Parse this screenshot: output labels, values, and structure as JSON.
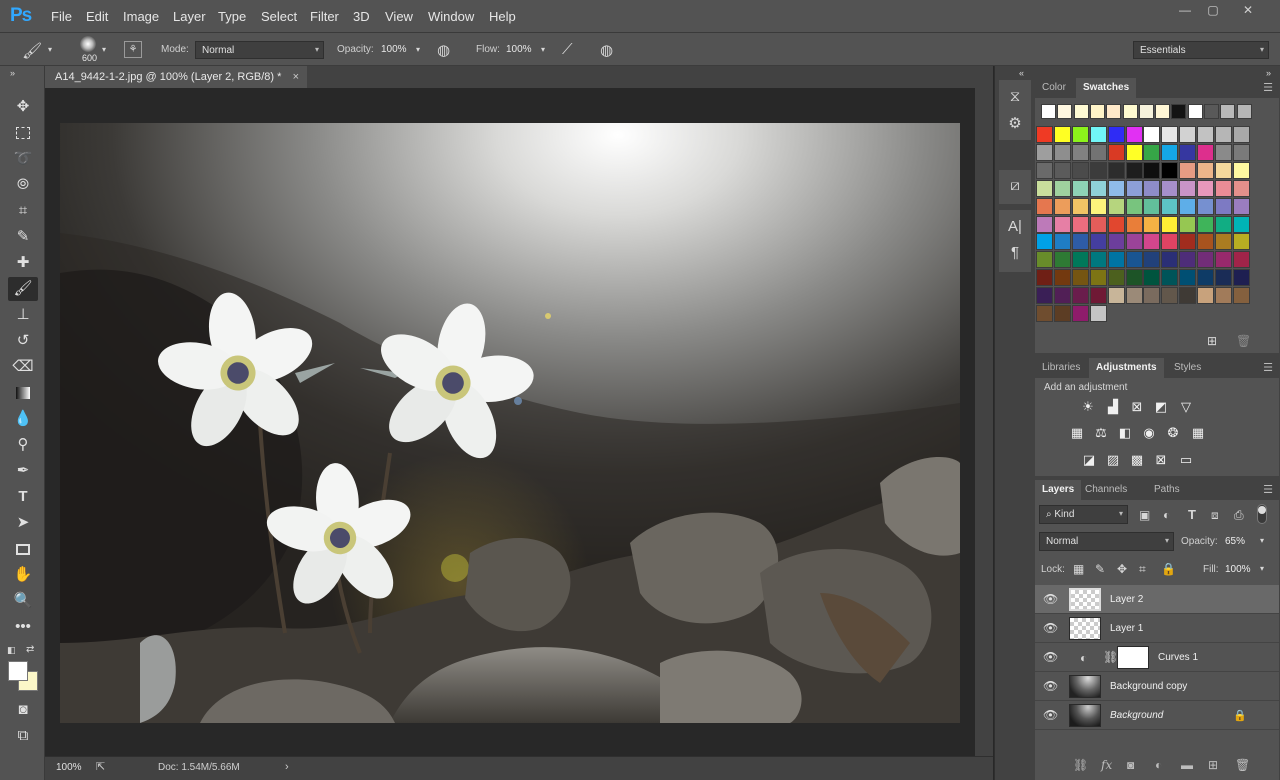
{
  "app": {
    "logo": "Ps",
    "accent": "#31a8ff"
  },
  "menu": [
    "File",
    "Edit",
    "Image",
    "Layer",
    "Type",
    "Select",
    "Filter",
    "3D",
    "View",
    "Window",
    "Help"
  ],
  "window_controls": [
    "minimize-icon",
    "restore-icon",
    "close-icon"
  ],
  "options_bar": {
    "brush_size": "600",
    "mode_label": "Mode:",
    "mode_value": "Normal",
    "opacity_label": "Opacity:",
    "opacity_value": "100%",
    "flow_label": "Flow:",
    "flow_value": "100%",
    "workspace": "Essentials"
  },
  "document": {
    "tab_title": "A14_9442-1-2.jpg @ 100% (Layer 2, RGB/8) *",
    "close": "×"
  },
  "status": {
    "zoom": "100%",
    "doc": "Doc: 1.54M/5.66M",
    "arrow": "›"
  },
  "tools": [
    "move-tool",
    "marquee-tool",
    "lasso-tool",
    "quick-select-tool",
    "crop-tool",
    "eyedropper-tool",
    "healing-brush-tool",
    "brush-tool",
    "clone-stamp-tool",
    "history-brush-tool",
    "eraser-tool",
    "gradient-tool",
    "blur-tool",
    "dodge-tool",
    "pen-tool",
    "type-tool",
    "path-select-tool",
    "rectangle-tool",
    "hand-tool",
    "zoom-tool",
    "more-tools"
  ],
  "colors": {
    "foreground": "#ffffff",
    "background": "#fbf7c8"
  },
  "color_panel": {
    "tabs": [
      "Color",
      "Swatches"
    ],
    "active_tab": "Swatches",
    "recent": [
      "#ffffff",
      "#fff7e0",
      "#fffbd4",
      "#fff4c8",
      "#ffe9c9",
      "#fffbd0",
      "#f6f2dc",
      "#fff6d5",
      "#141414",
      "#ffffff",
      "#595959",
      "#b9b9b9",
      "#b6b6b6"
    ],
    "swatches": [
      [
        "#ef3a24",
        "#ffff23",
        "#8cf31b",
        "#71f6f7",
        "#2f2cf5",
        "#e130f3",
        "#ffffff",
        "#e6e6e6",
        "#d2d2d2",
        "#c2c2c2",
        "#b6b6b6",
        "#a9a9a9"
      ],
      [
        "#9e9e9e",
        "#8e8e8e",
        "#818181",
        "#737373",
        "#d93a24",
        "#ffff26",
        "#36a647",
        "#14a7e5",
        "#3637a0",
        "#dd2f8d",
        "#8a8a8a",
        "#7a7a7a"
      ],
      [
        "#6a6a6a",
        "#5b5b5b",
        "#4b4b4b",
        "#3c3c3c",
        "#2d2d2d",
        "#1e1e1e",
        "#0f0f0f",
        "#000000",
        "#e69c83",
        "#ecb58a",
        "#f4d89c",
        "#fef8a1"
      ],
      [
        "#c9de9c",
        "#9fd19e",
        "#8ed2b6",
        "#8fd1d9",
        "#8fbbe9",
        "#8d9fd8",
        "#8e8cc9",
        "#a68fcb",
        "#c994c7",
        "#e798bb",
        "#ea8c96",
        "#e4908b"
      ],
      [
        "#e5774f",
        "#ec9d5b",
        "#f1c465",
        "#fdf37c",
        "#b6d57e",
        "#78c47e",
        "#62bf9b",
        "#5dc3c5",
        "#5eaee8",
        "#7690d0",
        "#7d7ac3",
        "#9a7dc0"
      ],
      [
        "#bd7ab9",
        "#e67fa5",
        "#eb6d7e",
        "#e45d5a",
        "#e1472f",
        "#e97e39",
        "#f4b244",
        "#ffee35",
        "#96c752",
        "#3fb45a",
        "#11ad83",
        "#00b3b6"
      ],
      [
        "#00a1e6",
        "#1f7dc4",
        "#2e5ca7",
        "#443ea0",
        "#6c3e9c",
        "#9b4399",
        "#d3468c",
        "#e04363",
        "#a12c1e",
        "#a8531e",
        "#ab7c21",
        "#b7ad22"
      ],
      [
        "#688c2a",
        "#2e7a34",
        "#00785a",
        "#00787f",
        "#0074a3",
        "#195592",
        "#22417a",
        "#2b2f76",
        "#4e2d79",
        "#722d78",
        "#98296c",
        "#a12449"
      ],
      [
        "#6f1f15",
        "#73390f",
        "#755512",
        "#7d7414",
        "#4c601e",
        "#1d5427",
        "#00543e",
        "#005459",
        "#004f73",
        "#0e3b66",
        "#1a2c56",
        "#1e1f51"
      ],
      [
        "#3a1f56",
        "#511f56",
        "#6a1d4c",
        "#6f1935",
        "#c8b599",
        "#9b8a78",
        "#7a6b5e",
        "#62574b",
        "#3f3a35",
        "#c8a27c",
        "#a17b5a",
        "#84603e"
      ],
      [
        "#6f4d2f",
        "#5c3d24",
        "#8e1c6b",
        "#c4c4c4"
      ]
    ],
    "footer_icons": [
      "new-swatch-icon",
      "delete-swatch-icon"
    ]
  },
  "adjustments_panel": {
    "tabs": [
      "Libraries",
      "Adjustments",
      "Styles"
    ],
    "active_tab": "Adjustments",
    "title": "Add an adjustment",
    "rows": [
      [
        "brightness-contrast-icon",
        "levels-icon",
        "curves-icon",
        "exposure-icon",
        "vibrance-icon"
      ],
      [
        "hue-saturation-icon",
        "color-balance-icon",
        "black-white-icon",
        "photo-filter-icon",
        "channel-mixer-icon",
        "color-lookup-icon"
      ],
      [
        "invert-icon",
        "posterize-icon",
        "threshold-icon",
        "selective-color-icon",
        "gradient-map-icon"
      ]
    ]
  },
  "layers_panel": {
    "tabs": [
      "Layers",
      "Channels",
      "Paths"
    ],
    "active_tab": "Layers",
    "filter": "Kind",
    "blend_mode": "Normal",
    "opacity_label": "Opacity:",
    "opacity": "65%",
    "lock_label": "Lock:",
    "fill_label": "Fill:",
    "fill": "100%",
    "layers": [
      {
        "name": "Layer 2",
        "selected": true,
        "type": "empty"
      },
      {
        "name": "Layer 1",
        "selected": false,
        "type": "empty"
      },
      {
        "name": "Curves 1",
        "selected": false,
        "type": "adjustment"
      },
      {
        "name": "Background copy",
        "selected": false,
        "type": "photo"
      },
      {
        "name": "Background",
        "selected": false,
        "type": "photo",
        "locked": true
      }
    ],
    "footer_icons": [
      "link-layers-icon",
      "fx-icon",
      "add-mask-icon",
      "new-adjustment-icon",
      "new-group-icon",
      "new-layer-icon",
      "delete-layer-icon"
    ]
  }
}
